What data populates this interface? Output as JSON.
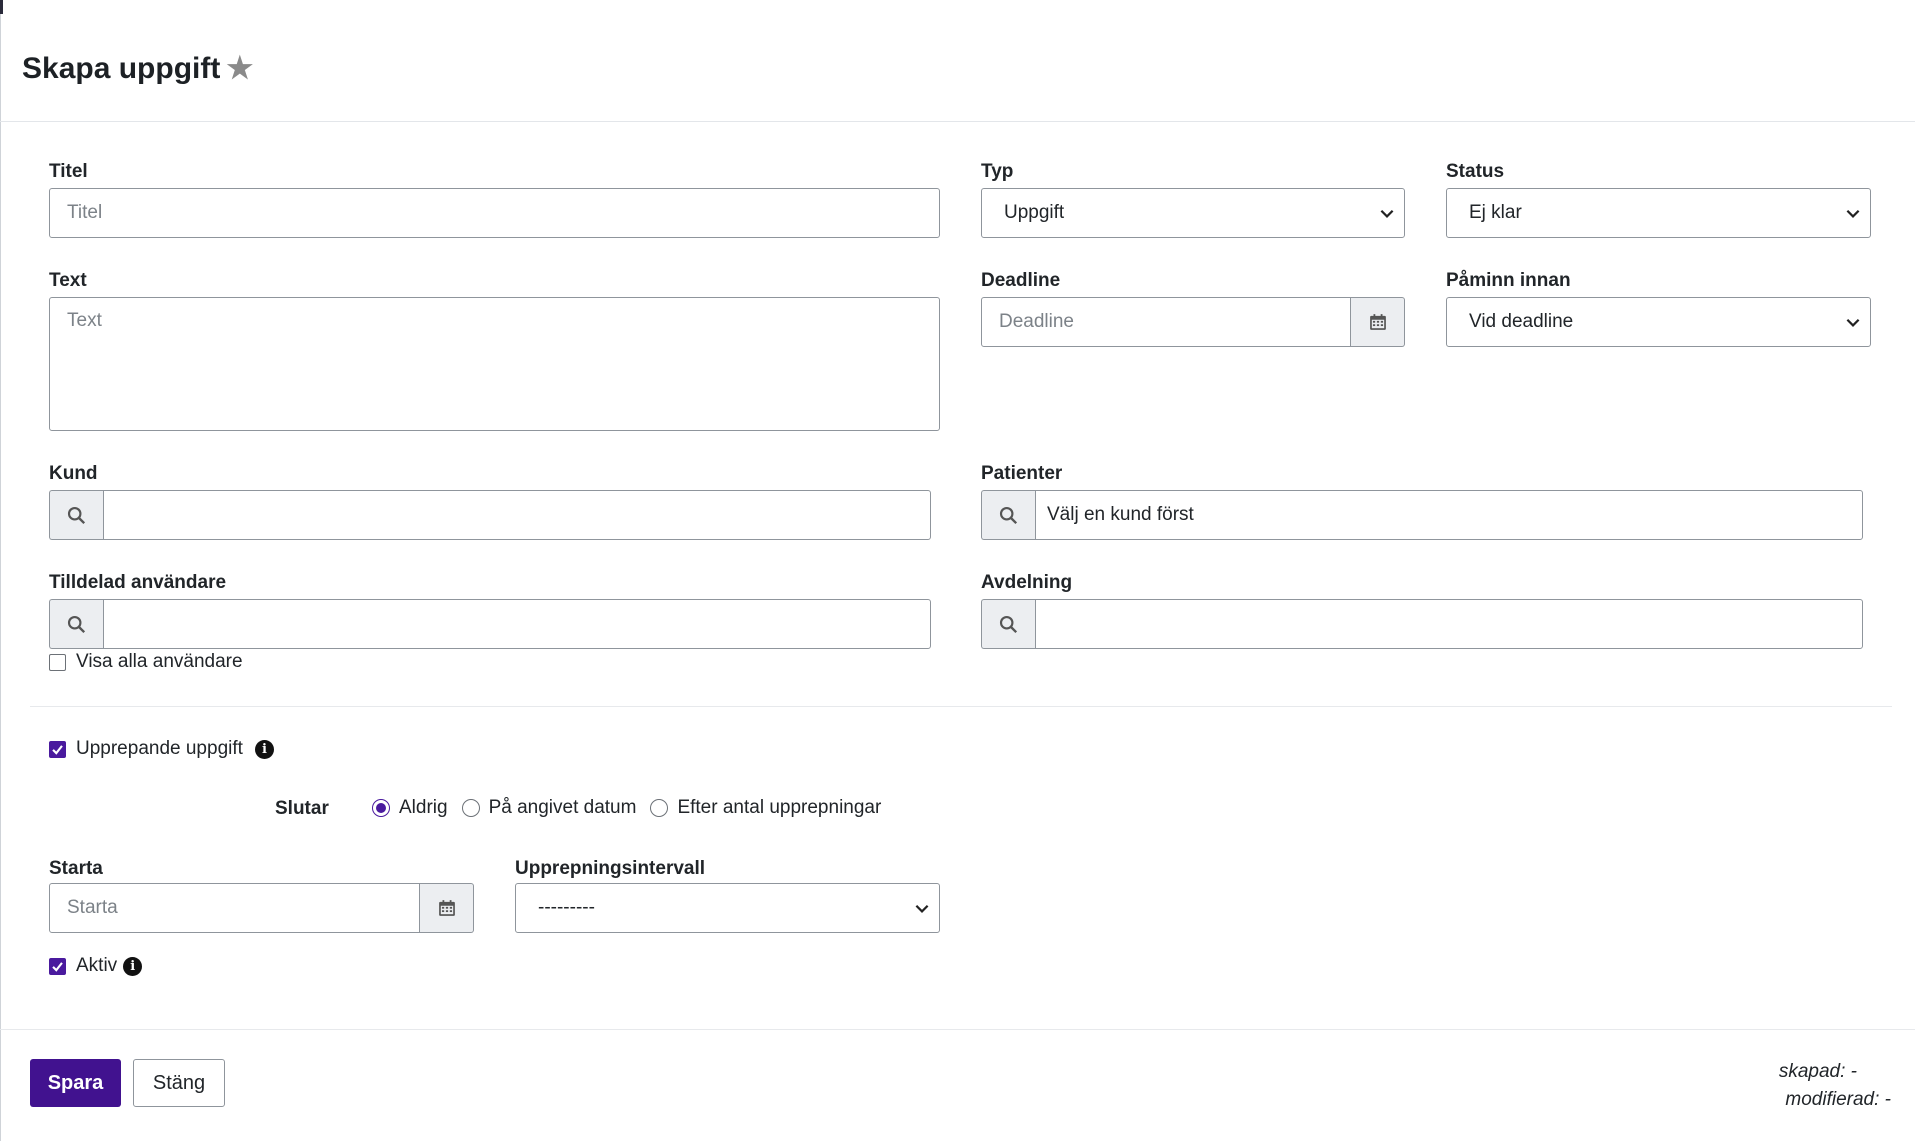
{
  "header": {
    "title": "Skapa uppgift",
    "star_glyph": "★"
  },
  "form": {
    "titel": {
      "label": "Titel",
      "placeholder": "Titel",
      "value": ""
    },
    "typ": {
      "label": "Typ",
      "value": "Uppgift"
    },
    "status": {
      "label": "Status",
      "value": "Ej klar"
    },
    "text": {
      "label": "Text",
      "placeholder": "Text",
      "value": ""
    },
    "deadline": {
      "label": "Deadline",
      "placeholder": "Deadline"
    },
    "paminn": {
      "label": "Påminn innan",
      "value": "Vid deadline"
    },
    "kund": {
      "label": "Kund",
      "value": ""
    },
    "patienter": {
      "label": "Patienter",
      "value": "Välj en kund först"
    },
    "tilldelad": {
      "label": "Tilldelad användare",
      "value": ""
    },
    "avdelning": {
      "label": "Avdelning",
      "value": ""
    },
    "visa_alla": {
      "label": "Visa alla användare",
      "checked": false
    }
  },
  "recurring": {
    "label": "Upprepande uppgift",
    "checked": true,
    "slutar": {
      "label": "Slutar",
      "options": [
        {
          "label": "Aldrig",
          "selected": true
        },
        {
          "label": "På angivet datum",
          "selected": false
        },
        {
          "label": "Efter antal upprepningar",
          "selected": false
        }
      ]
    },
    "starta": {
      "label": "Starta",
      "placeholder": "Starta"
    },
    "intervall": {
      "label": "Upprepningsintervall",
      "value": "---------"
    },
    "aktiv": {
      "label": "Aktiv",
      "checked": true
    }
  },
  "footer": {
    "save_label": "Spara",
    "close_label": "Stäng",
    "created": "skapad: -",
    "modified": "modifierad: -"
  },
  "colors": {
    "primary": "#41128f",
    "checkbox": "#4a1a9e",
    "border": "#8f959c",
    "addon_bg": "#eceef1"
  }
}
